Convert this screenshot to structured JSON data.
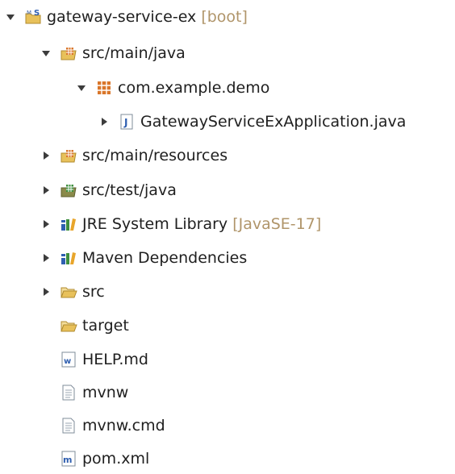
{
  "tree": {
    "items": [
      {
        "label": "gateway-service-ex",
        "decoration": "[boot]",
        "expanded": true,
        "level": 0,
        "icon": "spring-boot-project-icon"
      },
      {
        "label": "src/main/java",
        "expanded": true,
        "level": 1,
        "icon": "source-folder-icon"
      },
      {
        "label": "com.example.demo",
        "expanded": true,
        "level": 2,
        "icon": "package-icon"
      },
      {
        "label": "GatewayServiceExApplication.java",
        "expanded": false,
        "level": 3,
        "icon": "java-file-icon"
      },
      {
        "label": "src/main/resources",
        "expanded": false,
        "level": 1,
        "icon": "source-folder-icon"
      },
      {
        "label": "src/test/java",
        "expanded": false,
        "level": 1,
        "icon": "test-source-folder-icon"
      },
      {
        "label": "JRE System Library",
        "decoration": "[JavaSE-17]",
        "expanded": false,
        "level": 1,
        "icon": "library-icon"
      },
      {
        "label": "Maven Dependencies",
        "expanded": false,
        "level": 1,
        "icon": "library-icon"
      },
      {
        "label": "src",
        "expanded": false,
        "level": 1,
        "icon": "folder-icon"
      },
      {
        "label": "target",
        "level": 1,
        "icon": "folder-icon"
      },
      {
        "label": "HELP.md",
        "level": 1,
        "icon": "markdown-file-icon"
      },
      {
        "label": "mvnw",
        "level": 1,
        "icon": "text-file-icon"
      },
      {
        "label": "mvnw.cmd",
        "level": 1,
        "icon": "text-file-icon"
      },
      {
        "label": "pom.xml",
        "level": 1,
        "icon": "maven-pom-icon"
      }
    ]
  },
  "colors": {
    "decoration": "#b0956a",
    "folder": "#e8c15b",
    "package": "#d9762a",
    "java_blue": "#2f5fb0"
  }
}
